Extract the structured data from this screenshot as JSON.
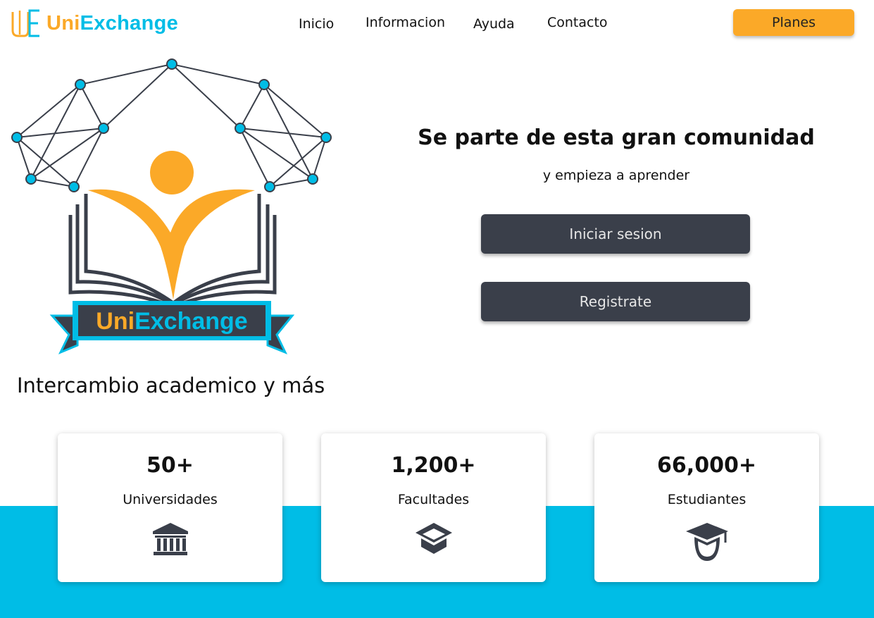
{
  "brand": {
    "name_part1": "Uni",
    "name_part2": "Exchange",
    "logo_letters": "UE"
  },
  "nav": {
    "items": [
      {
        "label": "Inicio"
      },
      {
        "label": "Informacion"
      },
      {
        "label": "Ayuda"
      },
      {
        "label": "Contacto"
      }
    ],
    "cta_label": "Planes"
  },
  "hero": {
    "title": "Se parte de esta gran comunidad",
    "subtitle": "y empieza a aprender",
    "login_label": "Iniciar sesion",
    "register_label": "Registrate",
    "tagline": "Intercambio academico y más"
  },
  "stats": [
    {
      "value": "50+",
      "label": "Universidades",
      "icon": "university-icon"
    },
    {
      "value": "1,200+",
      "label": "Facultades",
      "icon": "graduation-cap-icon"
    },
    {
      "value": "66,000+",
      "label": "Estudiantes",
      "icon": "student-icon"
    }
  ],
  "colors": {
    "accent_orange": "#fba928",
    "accent_cyan": "#00bde6",
    "button_dark": "#3a3f4a"
  }
}
